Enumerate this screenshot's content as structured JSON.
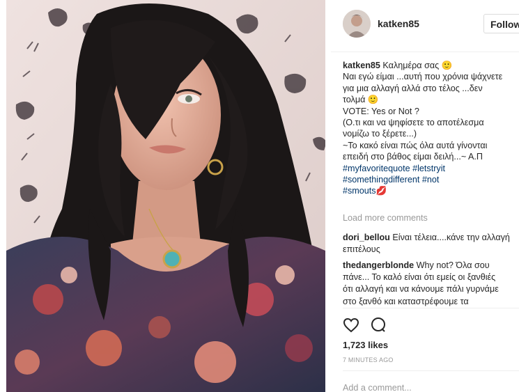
{
  "post": {
    "photo_icon": "selfie-photo",
    "username": "katken85",
    "follow_label": "Follow",
    "caption": {
      "author": "katken85",
      "first_line": "Καλημέρα σας 🙂",
      "lines": [
        "Ναι εγώ είμαι ...αυτή που χρόνια ψάχνετε",
        "για μια αλλαγή αλλά στο τέλος ...δεν",
        "τολμά 🙂",
        "VOTE: Yes or Not ?",
        "(Ο.τι και να ψηφίσετε το αποτέλεσμα",
        "νομίζω το ξέρετε...)",
        "~Το κακό είναι πώς όλα αυτά γίνονται",
        "επειδή στο βάθος είμαι δειλή...~ Α.Π"
      ],
      "hashtag_lines": [
        "#myfavoritequote #letstryit",
        "#somethingdifferent #not",
        "#smouts💋"
      ]
    },
    "load_more": "Load more comments",
    "comments": [
      {
        "author": "dori_bellou",
        "text_first": "Είναι τέλεια....κάνε την αλλαγή",
        "text_rest": [
          "επιτέλους"
        ]
      },
      {
        "author": "thedangerblonde",
        "text_first": "Why not? Όλα σου",
        "text_rest": [
          "πάνε... Το καλό είναι ότι εμείς οι ξανθιές",
          "ότι αλλαγή και να κάνουμε πάλι γυρνάμε",
          "στο ξανθό και καταστρέφουμε τα"
        ]
      }
    ],
    "icons": {
      "like": "heart-icon",
      "comment": "comment-icon"
    },
    "likes": "1,723 likes",
    "time": "7 MINUTES AGO",
    "add_comment_placeholder": "Add a comment..."
  }
}
